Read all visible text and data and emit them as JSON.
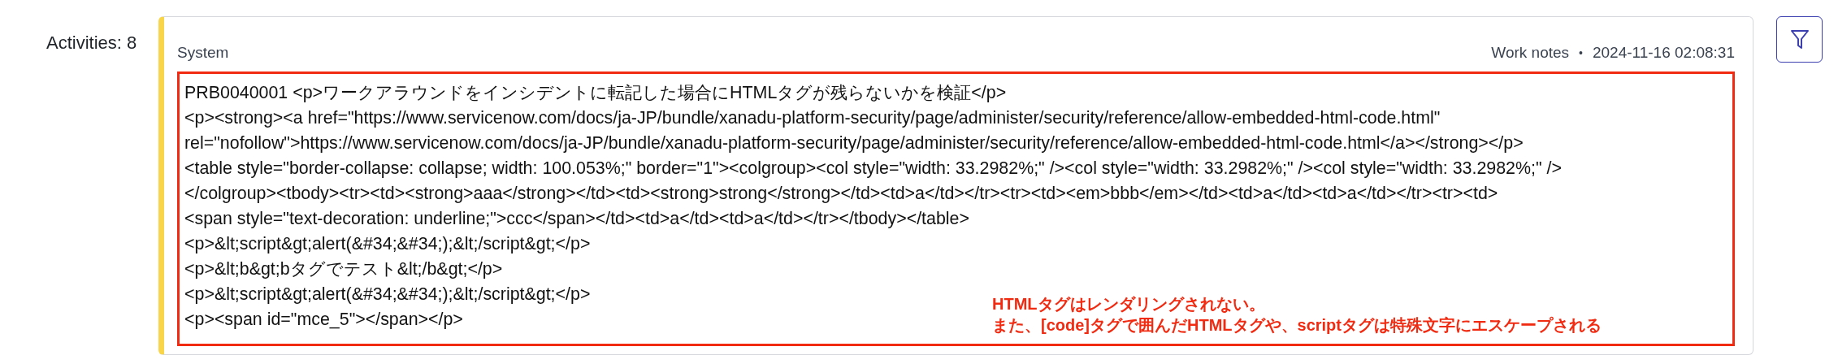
{
  "activities_label": "Activities: 8",
  "entry": {
    "author": "System",
    "type": "Work notes",
    "separator": "•",
    "timestamp": "2024-11-16 02:08:31",
    "highlighted": true,
    "lines": [
      "PRB0040001 <p>ワークアラウンドをインシデントに転記した場合にHTMLタグが残らないかを検証</p>",
      "<p><strong><a href=\"https://www.servicenow.com/docs/ja-JP/bundle/xanadu-platform-security/page/administer/security/reference/allow-embedded-html-code.html\"",
      "rel=\"nofollow\">https://www.servicenow.com/docs/ja-JP/bundle/xanadu-platform-security/page/administer/security/reference/allow-embedded-html-code.html</a></strong></p>",
      "<table style=\"border-collapse: collapse; width: 100.053%;\" border=\"1\"><colgroup><col style=\"width: 33.2982%;\" /><col style=\"width: 33.2982%;\" /><col style=\"width: 33.2982%;\" />",
      "</colgroup><tbody><tr><td><strong>aaa</strong></td><td><strong>strong</strong></td><td>a</td></tr><tr><td><em>bbb</em></td><td>a</td><td>a</td></tr><tr><td>",
      "<span style=\"text-decoration: underline;\">ccc</span></td><td>a</td><td>a</td></tr></tbody></table>",
      "<p>&lt;script&gt;alert(&#34;&#34;);&lt;/script&gt;</p>",
      "<p>&lt;b&gt;bタグでテスト&lt;/b&gt;</p>",
      "<p>&lt;script&gt;alert(&#34;&#34;);&lt;/script&gt;</p>",
      "<p><span id=\"mce_5\"></span></p>"
    ],
    "annotation": [
      "HTMLタグはレンダリングされない。",
      "また、[code]タグで囲んだHTMLタグや、scriptタグは特殊文字にエスケープされる"
    ]
  }
}
